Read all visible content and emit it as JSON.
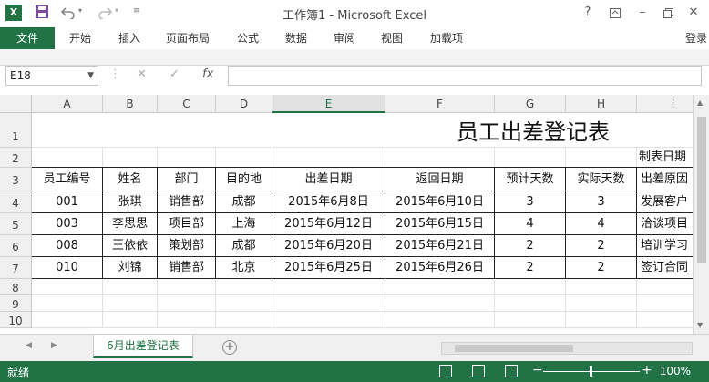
{
  "app": {
    "title": "工作簿1 - Microsoft Excel",
    "logo_text": "X",
    "icons": [
      "excel-logo-icon",
      "save-icon",
      "undo-icon",
      "redo-icon",
      "customize-qat-icon",
      "help-icon",
      "ribbon-display-icon",
      "minimize-icon",
      "restore-icon",
      "close-icon"
    ]
  },
  "ribbon": {
    "file_tab": "文件",
    "tabs": [
      "开始",
      "插入",
      "页面布局",
      "公式",
      "数据",
      "审阅",
      "视图",
      "加载项"
    ],
    "login": "登录"
  },
  "formula_bar": {
    "name_box": "E18",
    "cancel_symbol": "✕",
    "enter_symbol": "✓",
    "fx_symbol": "fx",
    "value": ""
  },
  "sheet": {
    "columns": [
      "A",
      "B",
      "C",
      "D",
      "E",
      "F",
      "G",
      "H",
      "I"
    ],
    "active_column": "E",
    "rows": [
      "1",
      "2",
      "3",
      "4",
      "5",
      "6",
      "7",
      "8",
      "9",
      "10"
    ],
    "title": "员工出差登记表",
    "date_label": "制表日期",
    "headers": [
      "员工编号",
      "姓名",
      "部门",
      "目的地",
      "出差日期",
      "返回日期",
      "预计天数",
      "实际天数",
      "出差原因"
    ],
    "data": [
      [
        "001",
        "张琪",
        "销售部",
        "成都",
        "2015年6月8日",
        "2015年6月10日",
        "3",
        "3",
        "发展客户"
      ],
      [
        "003",
        "李思思",
        "项目部",
        "上海",
        "2015年6月12日",
        "2015年6月15日",
        "4",
        "4",
        "洽谈项目"
      ],
      [
        "008",
        "王依依",
        "策划部",
        "成都",
        "2015年6月20日",
        "2015年6月21日",
        "2",
        "2",
        "培训学习"
      ],
      [
        "010",
        "刘锦",
        "销售部",
        "北京",
        "2015年6月25日",
        "2015年6月26日",
        "2",
        "2",
        "签订合同"
      ]
    ]
  },
  "sheet_tabs": {
    "active": "6月出差登记表",
    "add_symbol": "+"
  },
  "status_bar": {
    "ready": "就绪",
    "zoom_minus": "−",
    "zoom_plus": "+",
    "zoom": "100%"
  },
  "colors": {
    "brand": "#217346"
  }
}
